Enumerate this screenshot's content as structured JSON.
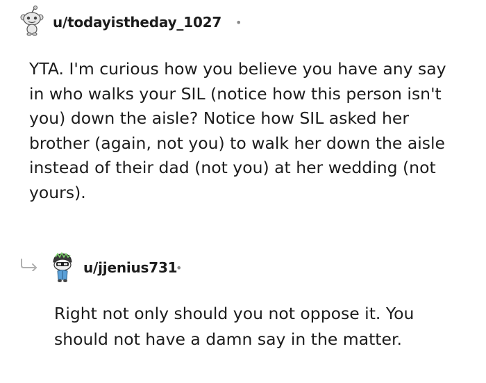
{
  "comments": [
    {
      "username": "u/todayistheday_1027",
      "separator": "•",
      "avatar_icon": "snoo-avatar-icon",
      "lines": [
        "YTA. I'm curious how you believe you have any say",
        "in who walks your SIL (notice how this person isn't",
        "you) down the aisle? Notice how SIL asked her",
        "brother (again, not you) to walk her down the aisle",
        "instead of their dad (not you) at her wedding (not",
        "yours)."
      ]
    },
    {
      "username": "u/jjenius731",
      "separator": "•",
      "avatar_icon": "custom-snoo-avatar-icon",
      "reply_icon": "reply-arrow-icon",
      "lines": [
        "Right not only should you not oppose it. You",
        "should not have a damn say in the matter."
      ]
    }
  ]
}
